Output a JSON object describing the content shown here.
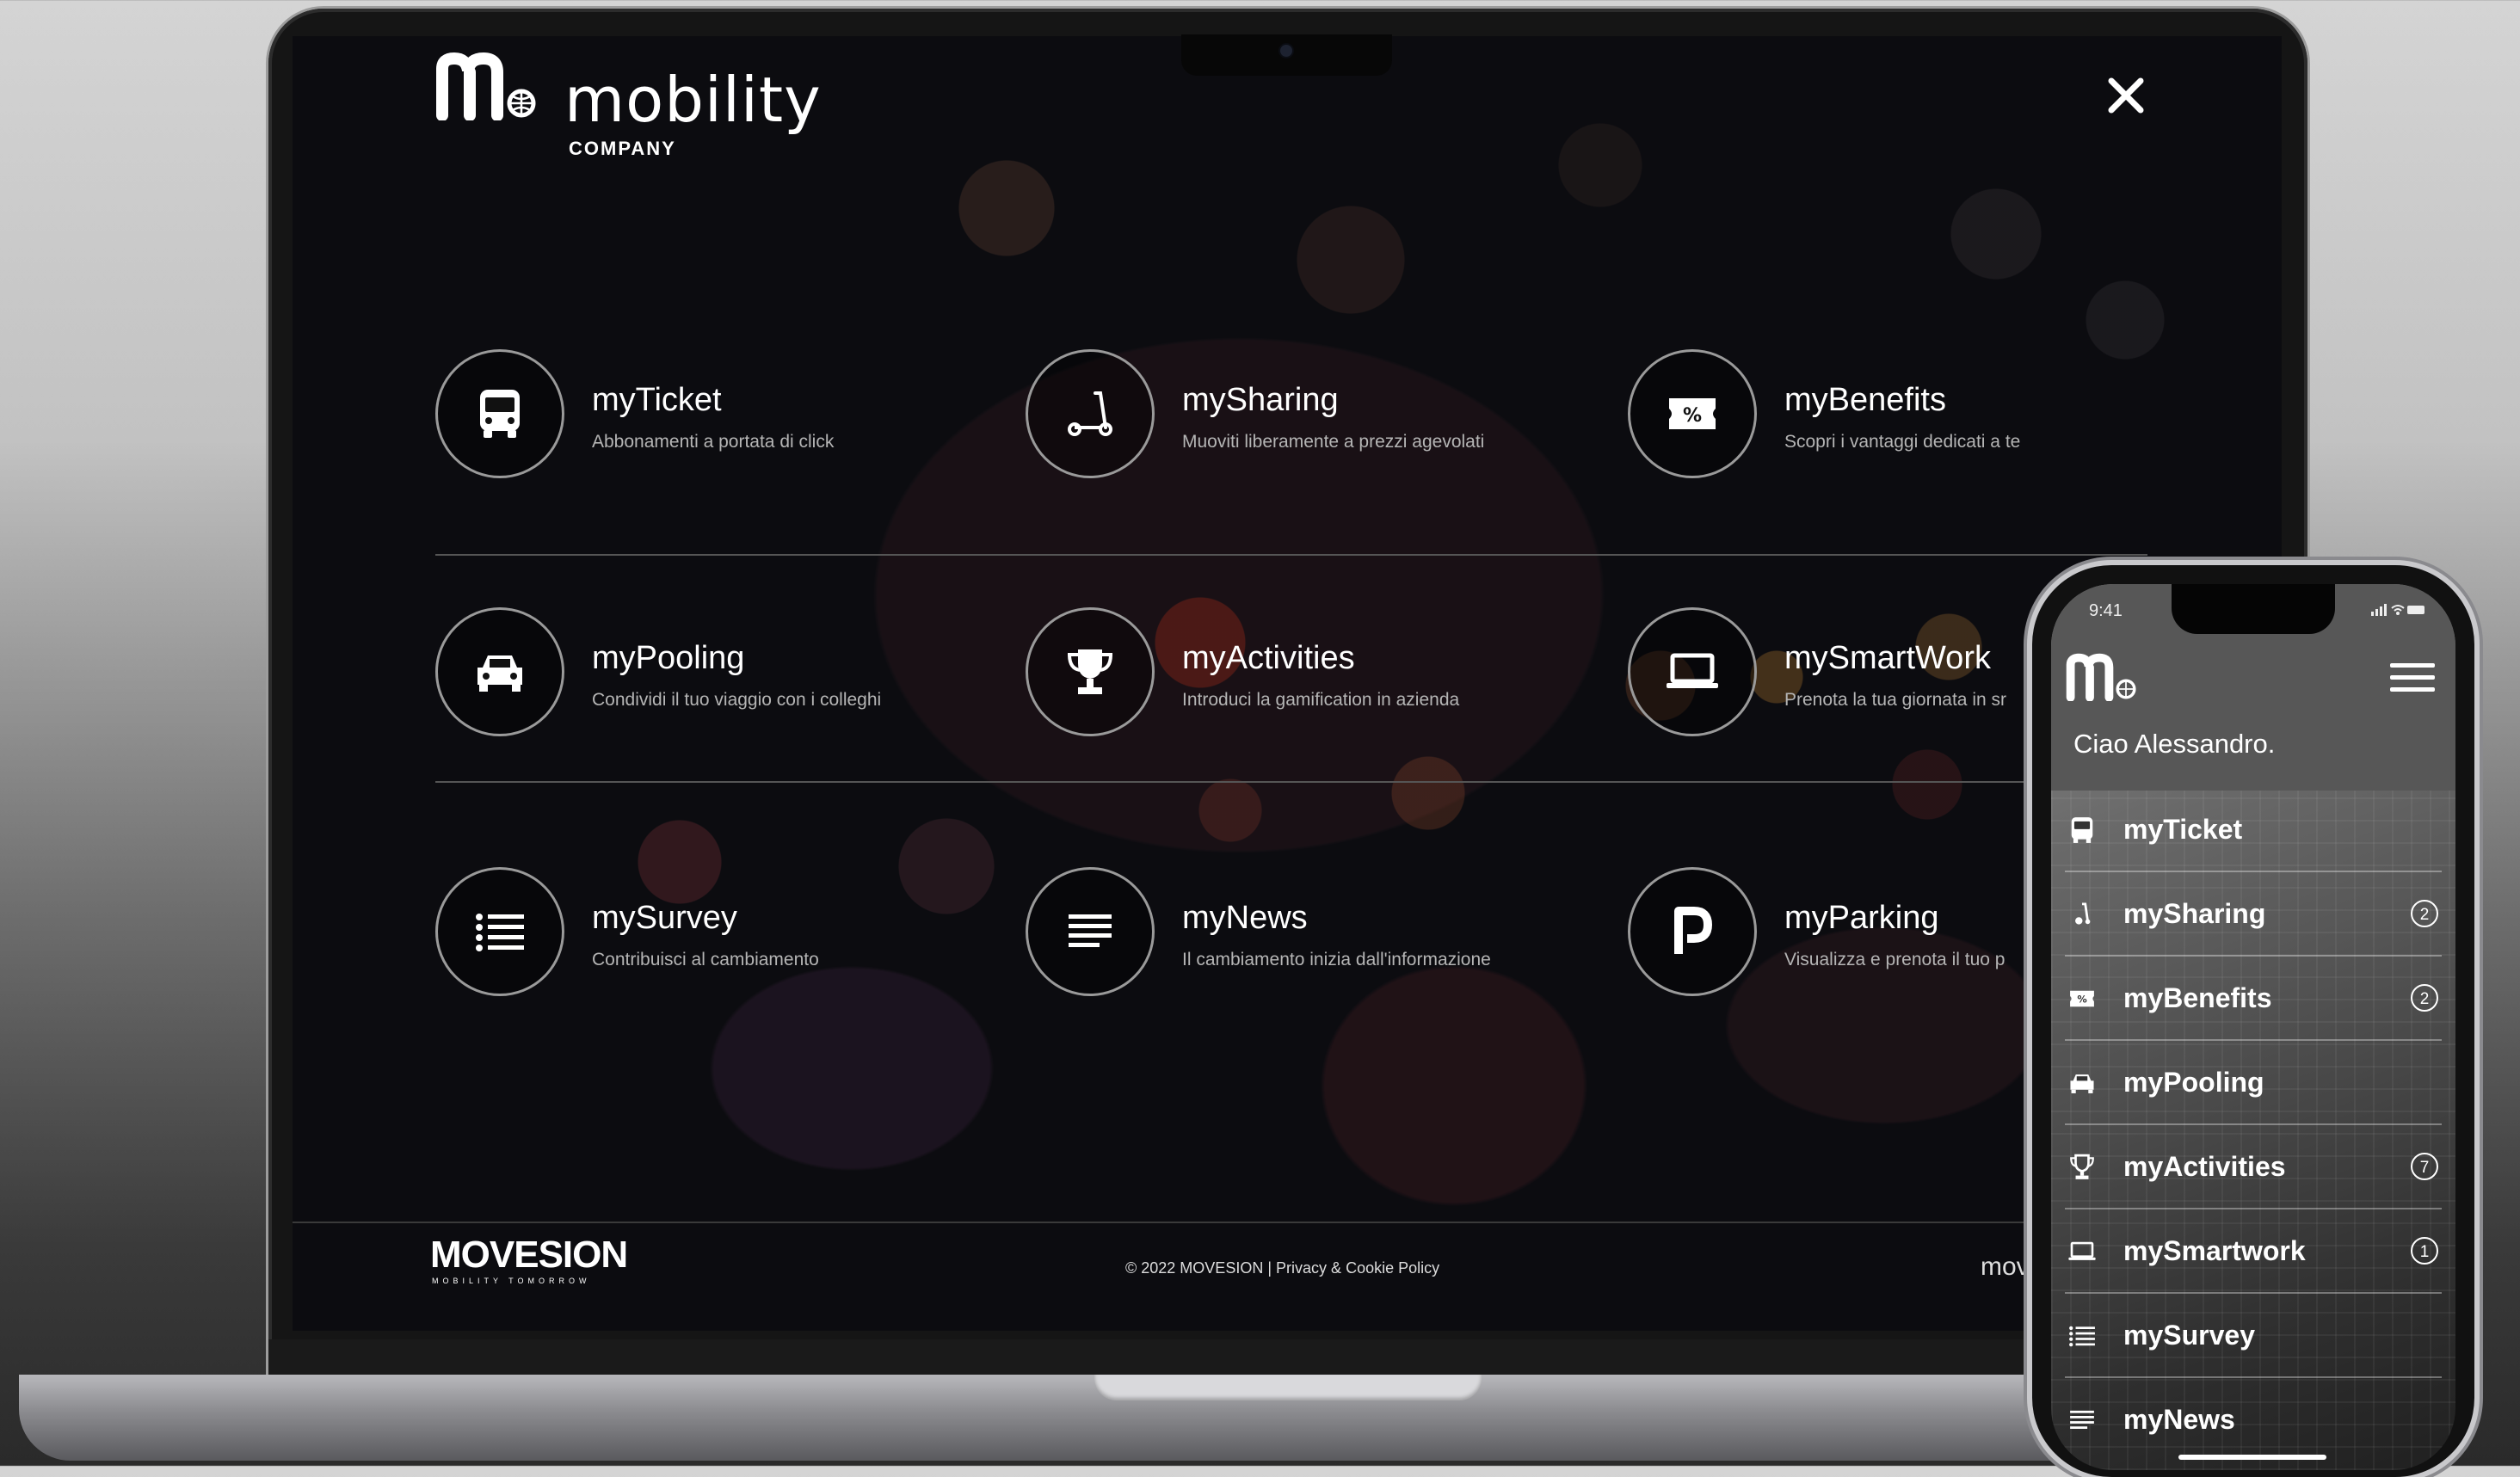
{
  "brand": {
    "word": "mobility",
    "subtitle": "COMPANY"
  },
  "tiles": [
    {
      "title": "myTicket",
      "desc": "Abbonamenti a portata di click",
      "icon": "bus-icon"
    },
    {
      "title": "mySharing",
      "desc": "Muoviti liberamente a prezzi agevolati",
      "icon": "scooter-icon"
    },
    {
      "title": "myBenefits",
      "desc": "Scopri i vantaggi dedicati a te",
      "icon": "discount-ticket-icon"
    },
    {
      "title": "myPooling",
      "desc": "Condividi il tuo viaggio con i colleghi",
      "icon": "car-icon"
    },
    {
      "title": "myActivities",
      "desc": "Introduci la gamification in azienda",
      "icon": "trophy-icon"
    },
    {
      "title": "mySmartWork",
      "desc": "Prenota la tua giornata in sr",
      "icon": "laptop-icon"
    },
    {
      "title": "mySurvey",
      "desc": "Contribuisci al cambiamento",
      "icon": "list-icon"
    },
    {
      "title": "myNews",
      "desc": "Il cambiamento inizia dall'informazione",
      "icon": "text-lines-icon"
    },
    {
      "title": "myParking",
      "desc": "Visualizza e prenota il tuo p",
      "icon": "parking-icon"
    }
  ],
  "footer": {
    "logo_main": "MOVESION",
    "logo_sub": "MOBILITY TOMORROW",
    "copyright": "© 2022 MOVESION",
    "separator": "|",
    "policy_link": "Privacy & Cookie Policy",
    "right_text": "mov"
  },
  "phone": {
    "status_time": "9:41",
    "greeting": "Ciao Alessandro.",
    "menu": [
      {
        "label": "myTicket",
        "icon": "bus-icon",
        "badge": ""
      },
      {
        "label": "mySharing",
        "icon": "scooter-icon",
        "badge": "2"
      },
      {
        "label": "myBenefits",
        "icon": "discount-ticket-icon",
        "badge": "2"
      },
      {
        "label": "myPooling",
        "icon": "car-icon",
        "badge": ""
      },
      {
        "label": "myActivities",
        "icon": "trophy-icon",
        "badge": "7"
      },
      {
        "label": "mySmartwork",
        "icon": "laptop-icon",
        "badge": "1"
      },
      {
        "label": "mySurvey",
        "icon": "list-icon",
        "badge": ""
      },
      {
        "label": "myNews",
        "icon": "text-lines-icon",
        "badge": ""
      }
    ]
  },
  "colors": {
    "screen_bg": "#0f0f12",
    "circle_border": "#9a9a9a",
    "text": "#ffffff",
    "muted": "#b5b5b5"
  }
}
